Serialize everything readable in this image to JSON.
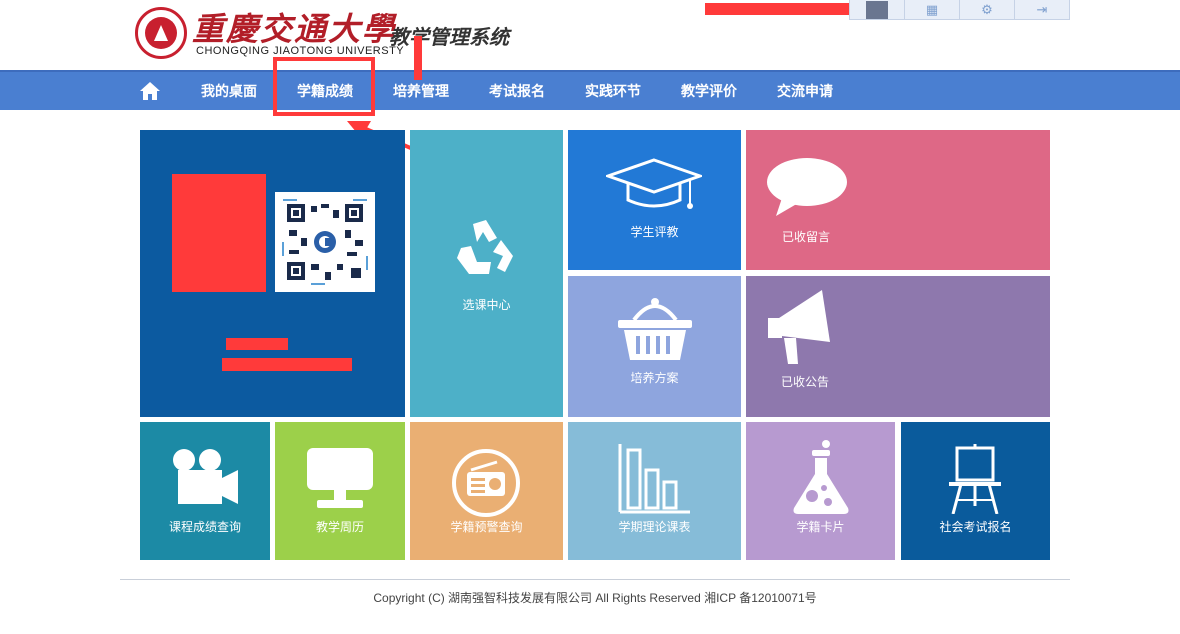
{
  "header": {
    "uni_cn": "重慶交通大學",
    "uni_en": "CHONGQING JIAOTONG UNIVERSTY",
    "system_title": "教学管理系统"
  },
  "nav": {
    "items": [
      "我的桌面",
      "学籍成绩",
      "培养管理",
      "考试报名",
      "实践环节",
      "教学评价",
      "交流申请"
    ]
  },
  "tiles": {
    "course_select": "选课中心",
    "student_eval": "学生评教",
    "messages": "已收留言",
    "training_plan": "培养方案",
    "announcements": "已收公告",
    "grade_query": "课程成绩查询",
    "calendar": "教学周历",
    "warning_query": "学籍预警查询",
    "theory_schedule": "学期理论课表",
    "status_card": "学籍卡片",
    "social_exam": "社会考试报名"
  },
  "colors": {
    "nav_bg": "#4a7fd1",
    "tile_profile": "#0c5aa0",
    "tile_course": "#4db0c8",
    "tile_eval": "#2279d6",
    "tile_msg": "#de6886",
    "tile_plan": "#8ea5de",
    "tile_announce": "#8e78ad",
    "tile_grade": "#1c8aa5",
    "tile_calendar": "#9cd04a",
    "tile_warning": "#eaaf73",
    "tile_theory": "#86bcd8",
    "tile_card": "#b79ad0",
    "tile_social": "#0a5b9c",
    "annotation_red": "#ff3a3a"
  },
  "footer": {
    "copyright": "Copyright (C) 湖南强智科技发展有限公司 All Rights Reserved 湘ICP 备12010071号"
  }
}
